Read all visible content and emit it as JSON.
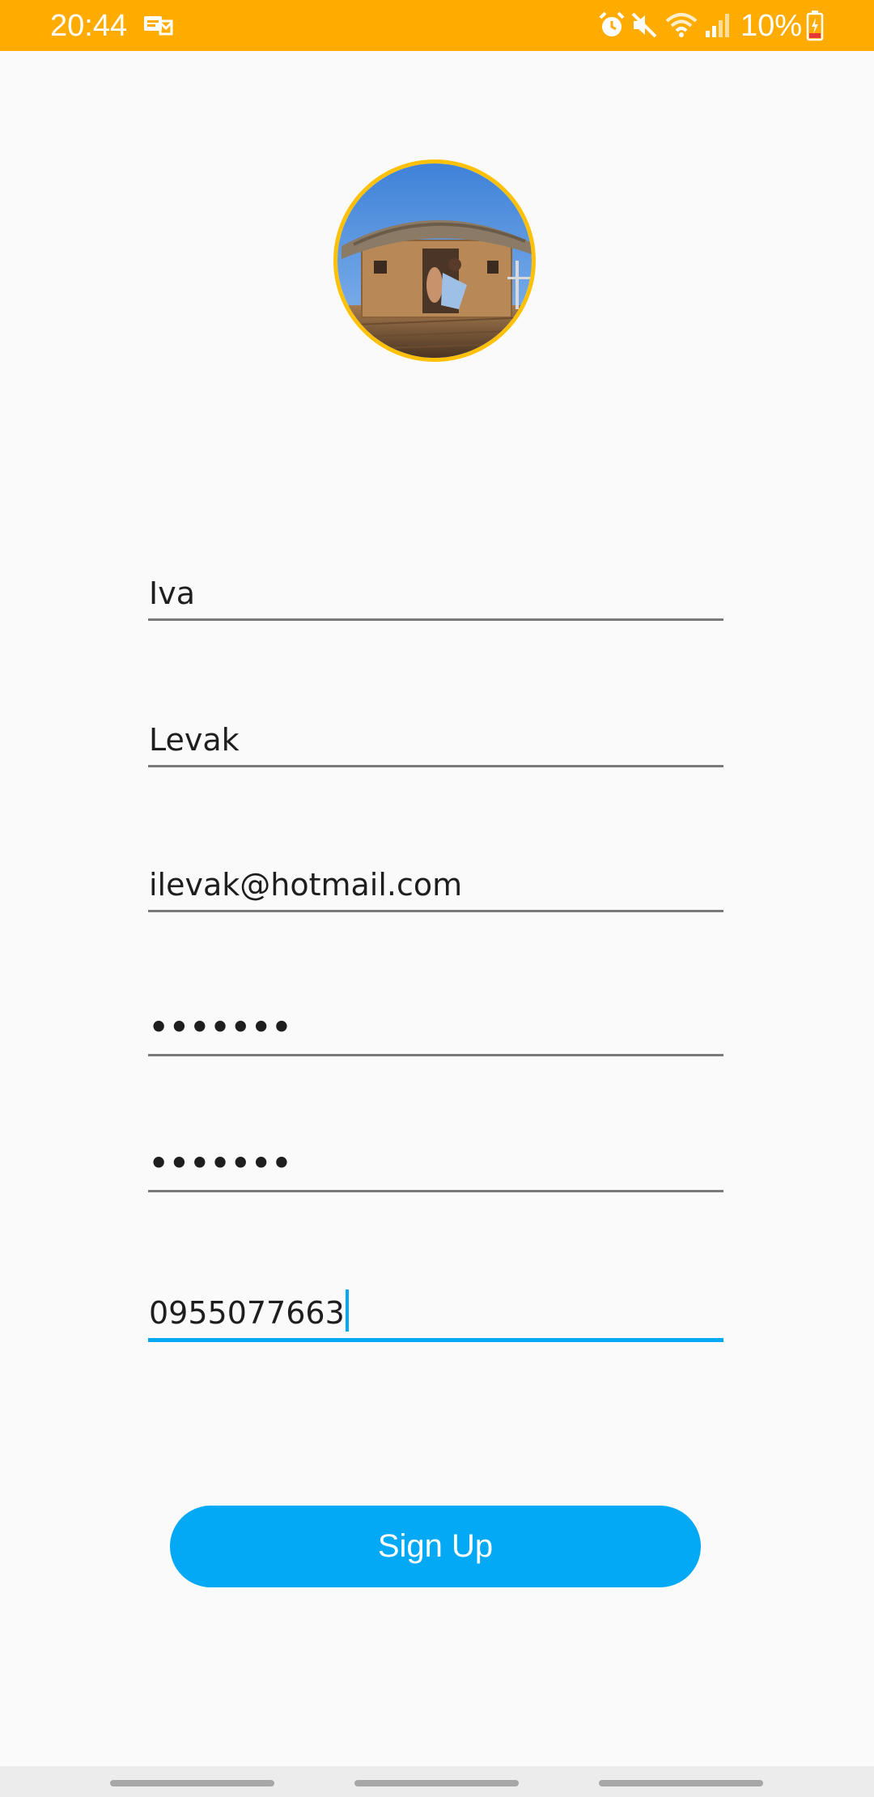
{
  "status_bar": {
    "time": "20:44",
    "battery": "10%",
    "background": "#ffab00",
    "icons": [
      "message-notification-icon",
      "alarm-icon",
      "mute-icon",
      "wifi-icon",
      "signal-icon",
      "battery-charging-icon"
    ]
  },
  "profile": {
    "avatar": "profile-photo"
  },
  "form": {
    "first_name": "Iva",
    "last_name": "Levak",
    "email": "ilevak@hotmail.com",
    "password": "•••••••",
    "confirm_password": "•••••••",
    "phone": "0955077663"
  },
  "actions": {
    "signup_label": "Sign Up"
  },
  "colors": {
    "accent": "#03a9f4",
    "avatar_border": "#ffc107",
    "status_bar": "#ffab00"
  }
}
